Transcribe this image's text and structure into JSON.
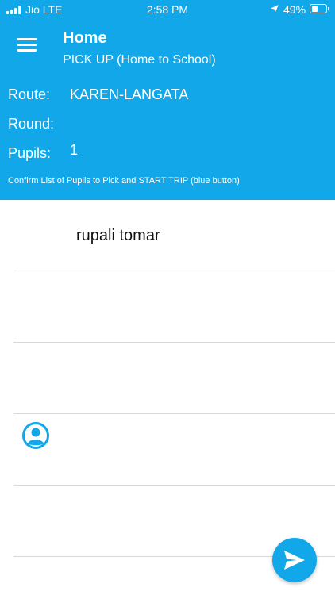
{
  "status_bar": {
    "carrier": "Jio LTE",
    "time": "2:58 PM",
    "battery": "49%",
    "battery_level": 0.49
  },
  "header": {
    "title": "Home",
    "subtitle": "PICK UP (Home to School)",
    "route_label": "Route:",
    "route_value": "KAREN-LANGATA",
    "round_label": "Round:",
    "round_value": "",
    "pupils_label": "Pupils:",
    "pupils_value": "1",
    "hint": "Confirm List of Pupils to Pick and START TRIP (blue button)"
  },
  "pupils": [
    {
      "name": "rupali  tomar"
    }
  ],
  "colors": {
    "primary": "#11a7e8",
    "divider": "#d8d8d8"
  },
  "icons": {
    "menu": "menu-icon",
    "avatar": "user-avatar-icon",
    "fab": "send-icon"
  }
}
